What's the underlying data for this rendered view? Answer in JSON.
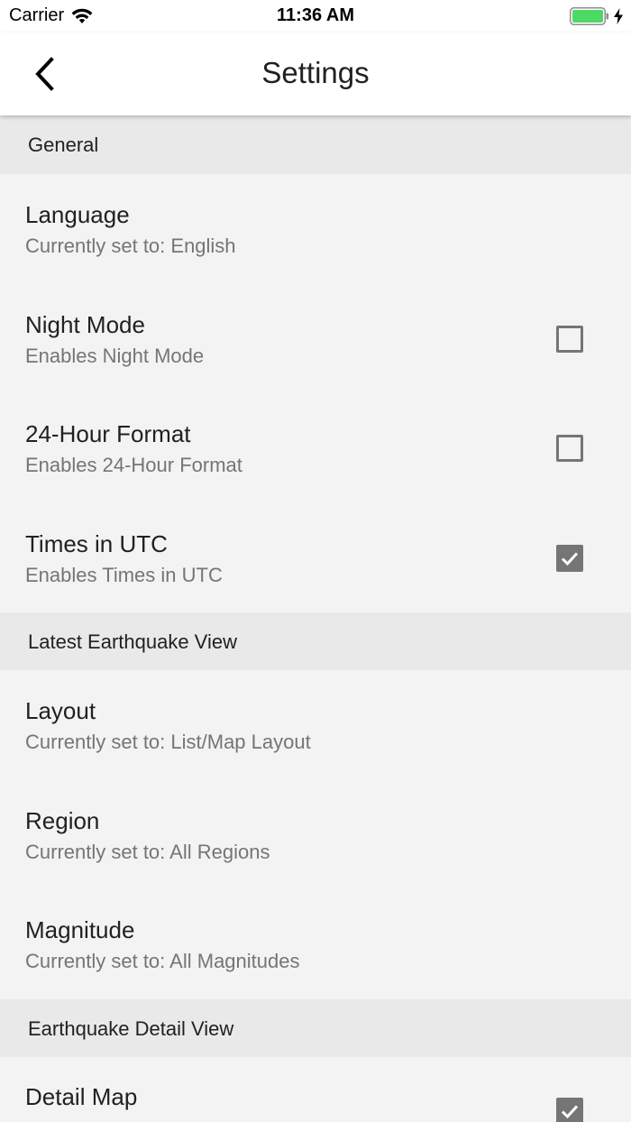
{
  "status_bar": {
    "carrier": "Carrier",
    "time": "11:36 AM"
  },
  "nav": {
    "title": "Settings"
  },
  "sections": [
    {
      "header": "General",
      "rows": [
        {
          "title": "Language",
          "subtitle": "Currently set to: English"
        },
        {
          "title": "Night Mode",
          "subtitle": "Enables Night Mode",
          "checked": false
        },
        {
          "title": "24-Hour Format",
          "subtitle": "Enables 24-Hour Format",
          "checked": false
        },
        {
          "title": "Times in UTC",
          "subtitle": "Enables Times in UTC",
          "checked": true
        }
      ]
    },
    {
      "header": "Latest Earthquake View",
      "rows": [
        {
          "title": "Layout",
          "subtitle": "Currently set to: List/Map Layout"
        },
        {
          "title": "Region",
          "subtitle": "Currently set to: All Regions"
        },
        {
          "title": "Magnitude",
          "subtitle": "Currently set to: All Magnitudes"
        }
      ]
    },
    {
      "header": "Earthquake Detail View",
      "rows": [
        {
          "title": "Detail Map",
          "subtitle": "",
          "checked": true
        }
      ]
    }
  ],
  "colors": {
    "battery": "#4cd964",
    "checkbox": "#757575",
    "section_header_bg": "#e9e9e9",
    "background": "#f3f3f3"
  }
}
